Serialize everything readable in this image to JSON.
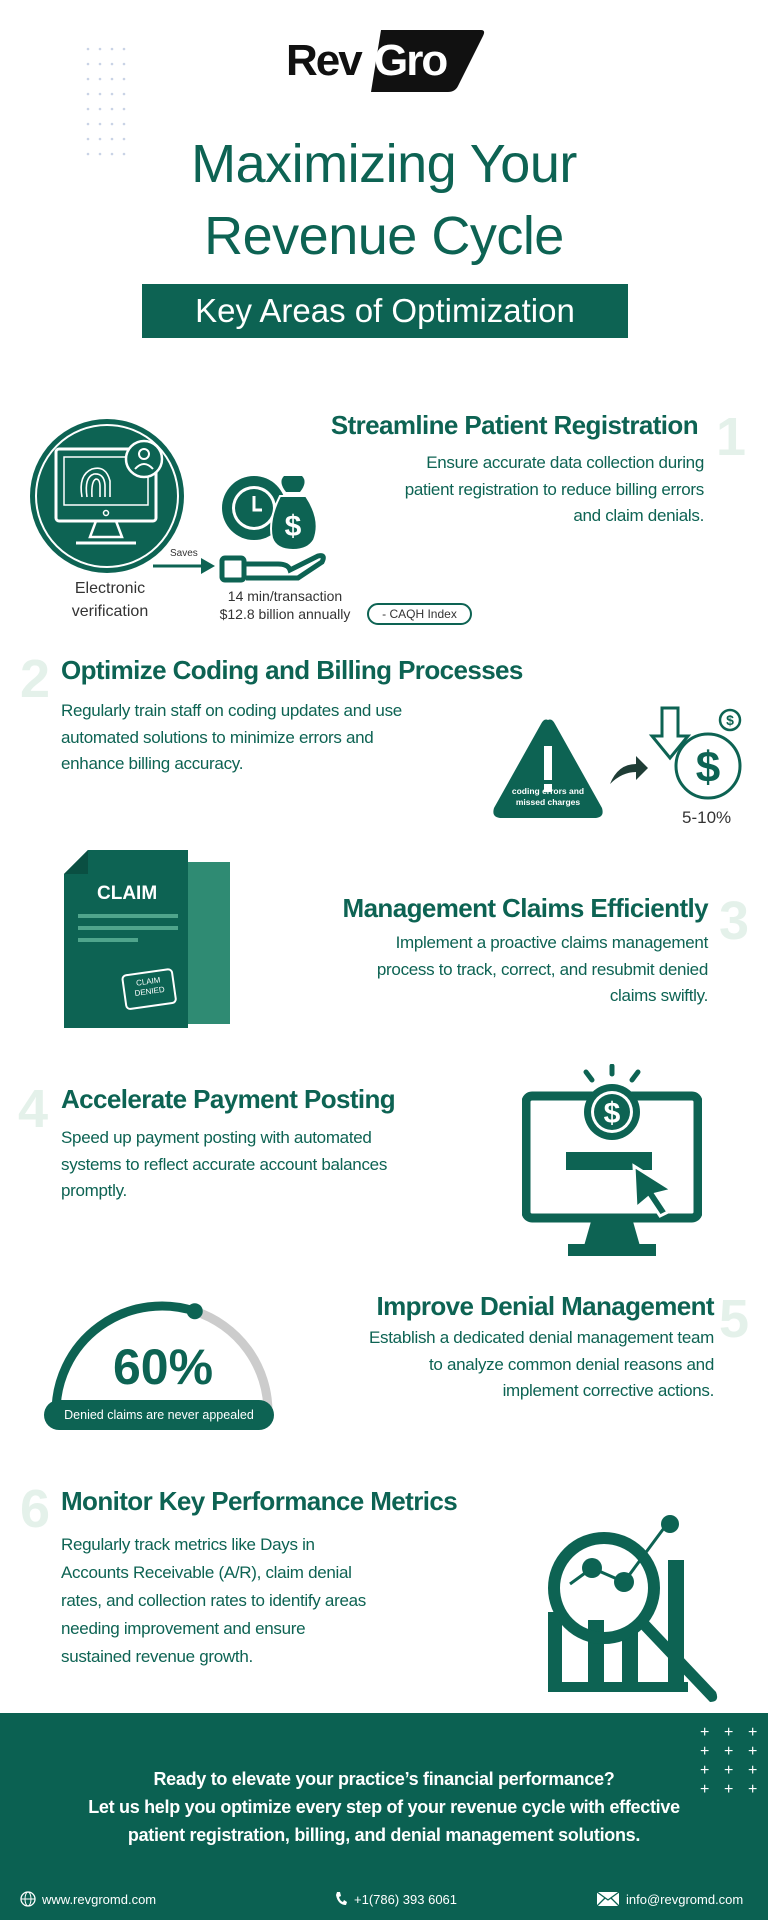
{
  "brand": {
    "logo_text_left": "Rev",
    "logo_text_right": "Gro"
  },
  "header": {
    "title_lines": [
      "Maximizing Your",
      "Revenue Cycle"
    ],
    "subtitle": "Key Areas of Optimization"
  },
  "colors": {
    "primary": "#0d6353",
    "number_tint": "#e4f1ea",
    "footer": "#0b6152",
    "gauge_track": "#cccccc"
  },
  "sections": [
    {
      "number": "1",
      "title": "Streamline Patient Registration",
      "body_lines": [
        "Ensure accurate data collection during",
        "patient registration to reduce billing errors",
        "and claim denials."
      ],
      "icon": "fingerprint-monitor-icon",
      "icon_label_lines": [
        "Electronic",
        "verification"
      ],
      "arrow_label": "Saves",
      "stat_icon": "time-money-hand-icon",
      "stat_lines": [
        "14 min/transaction",
        "$12.8 billion annually"
      ],
      "source": "- CAQH Index"
    },
    {
      "number": "2",
      "title": "Optimize Coding and Billing Processes",
      "body_lines": [
        "Regularly train staff on coding updates and use",
        "automated solutions to minimize errors and",
        "enhance billing accuracy."
      ],
      "warning_label_lines": [
        "coding errors and",
        "missed charges"
      ],
      "stat": "5-10%"
    },
    {
      "number": "3",
      "title": "Management Claims Efficiently",
      "body_lines": [
        "Implement a proactive claims management",
        "process to track, correct, and resubmit denied",
        "claims swiftly."
      ],
      "doc_title": "CLAIM",
      "stamp_lines": [
        "CLAIM",
        "DENIED"
      ]
    },
    {
      "number": "4",
      "title": "Accelerate Payment Posting",
      "body_lines": [
        "Speed up payment posting with automated",
        "systems to reflect accurate account balances",
        "promptly."
      ]
    },
    {
      "number": "5",
      "title": "Improve Denial Management",
      "body_lines": [
        "Establish a dedicated denial management team",
        "to analyze common denial reasons and",
        "implement corrective actions."
      ],
      "gauge_value": "60%",
      "gauge_fraction": 0.6,
      "gauge_caption": "Denied claims are never appealed"
    },
    {
      "number": "6",
      "title": "Monitor Key Performance Metrics",
      "body_lines": [
        "Regularly track metrics like Days in",
        "Accounts Receivable (A/R), claim denial",
        "rates, and collection rates to identify areas",
        "needing improvement and ensure",
        "sustained revenue growth."
      ]
    }
  ],
  "footer": {
    "cta_lines": [
      "Ready to elevate your practice’s financial performance?",
      "Let us help you optimize every step of your revenue cycle with effective",
      "patient registration, billing, and denial management solutions."
    ],
    "website": "www.revgromd.com",
    "phone": "+1(786) 393 6061",
    "email": "info@revgromd.com"
  }
}
